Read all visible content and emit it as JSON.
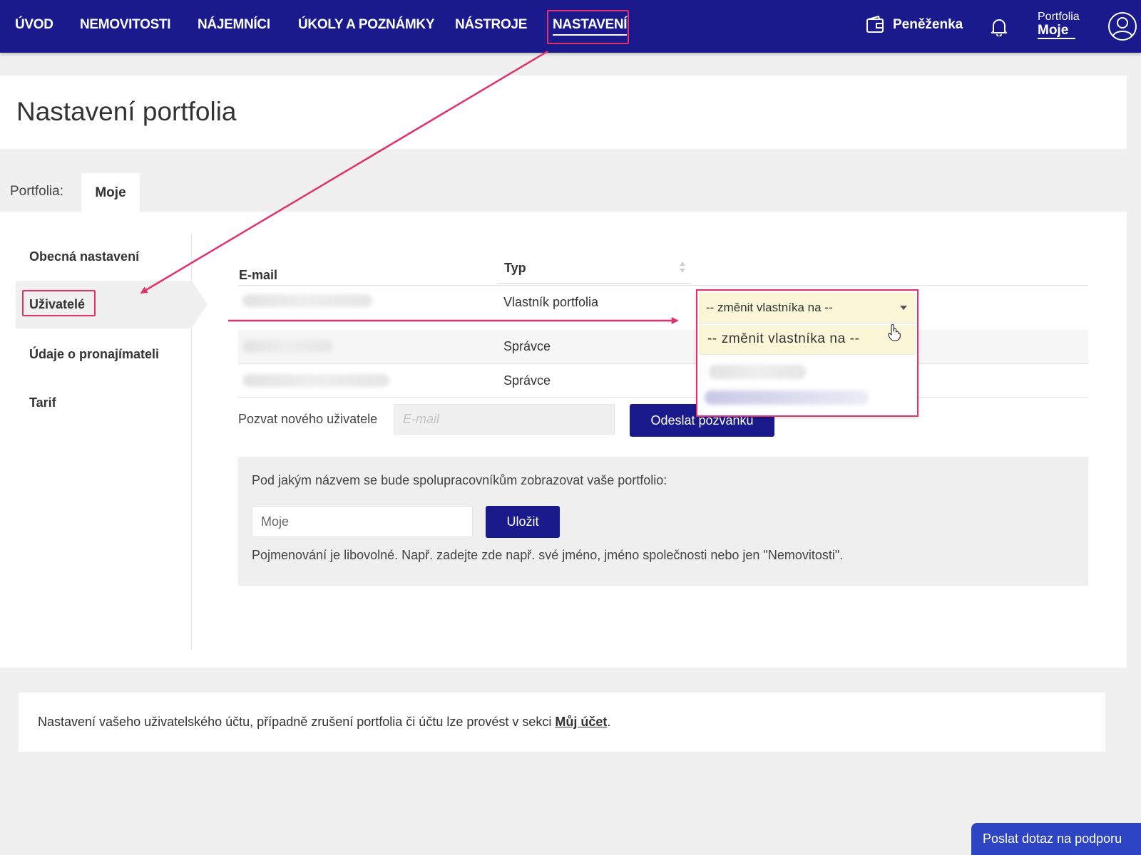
{
  "nav": {
    "items": [
      "ÚVOD",
      "NEMOVITOSTI",
      "NÁJEMNÍCI",
      "ÚKOLY A POZNÁMKY",
      "NÁSTROJE"
    ],
    "active": "NASTAVENÍ",
    "wallet_label": "Peněženka",
    "portfolio_label": "Portfolia",
    "portfolio_value": "Moje"
  },
  "page": {
    "title": "Nastavení portfolia"
  },
  "tabs": {
    "label": "Portfolia:",
    "active": "Moje"
  },
  "sidebar": {
    "items": [
      "Obecná nastavení",
      "Uživatelé",
      "Údaje o pronajímateli",
      "Tarif"
    ],
    "active_index": 1
  },
  "table": {
    "headers": {
      "email": "E-mail",
      "type": "Typ"
    },
    "rows": [
      {
        "type": "Vlastník portfolia"
      },
      {
        "type": "Správce"
      },
      {
        "type": "Správce"
      }
    ]
  },
  "owner_select": {
    "selected": "-- změnit vlastníka na --",
    "options": [
      "-- změnit vlastníka na --"
    ]
  },
  "invite": {
    "label": "Pozvat nového uživatele",
    "placeholder": "E-mail",
    "button": "Odeslat pozvánku"
  },
  "display_name": {
    "question": "Pod jakým názvem se bude spolupracovníkům zobrazovat vaše portfolio:",
    "value": "Moje",
    "save_button": "Uložit",
    "hint": "Pojmenování je libovolné. Např. zadejte zde např. své jméno, jméno společnosti nebo jen \"Nemovitosti\"."
  },
  "footer": {
    "text": "Nastavení vašeho uživatelského účtu, případně zrušení portfolia či účtu lze provést v sekci ",
    "link": "Můj účet",
    "suffix": "."
  },
  "support_button": "Poslat dotaz na podporu",
  "colors": {
    "nav_bg": "#1a1a8c",
    "accent_button": "#1a1a8c",
    "annotation": "#e0306e",
    "support": "#2d44c4"
  }
}
